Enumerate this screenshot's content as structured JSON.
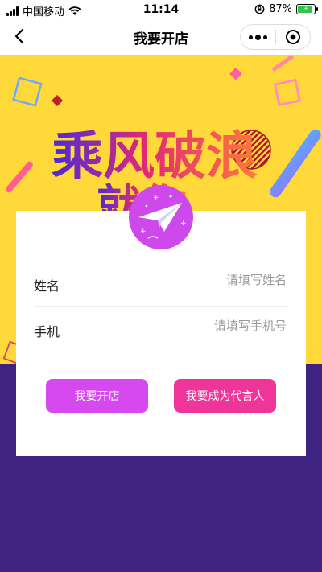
{
  "status_bar": {
    "carrier": "中国移动",
    "time": "11:14",
    "battery": "87%"
  },
  "nav": {
    "title": "我要开店"
  },
  "banner": {
    "headline_line1": "乘风破浪",
    "headline_line2": "就你",
    "colors": {
      "yellow": "#ffd93a",
      "purple": "#3e2383"
    }
  },
  "form": {
    "name": {
      "label": "姓名",
      "placeholder": "请填写姓名"
    },
    "phone": {
      "label": "手机",
      "placeholder": "请填写手机号"
    }
  },
  "buttons": {
    "open_shop": "我要开店",
    "spokesperson": "我要成为代言人"
  },
  "colors": {
    "open_shop_btn": "#d649f0",
    "spokesperson_btn": "#f0359a"
  }
}
